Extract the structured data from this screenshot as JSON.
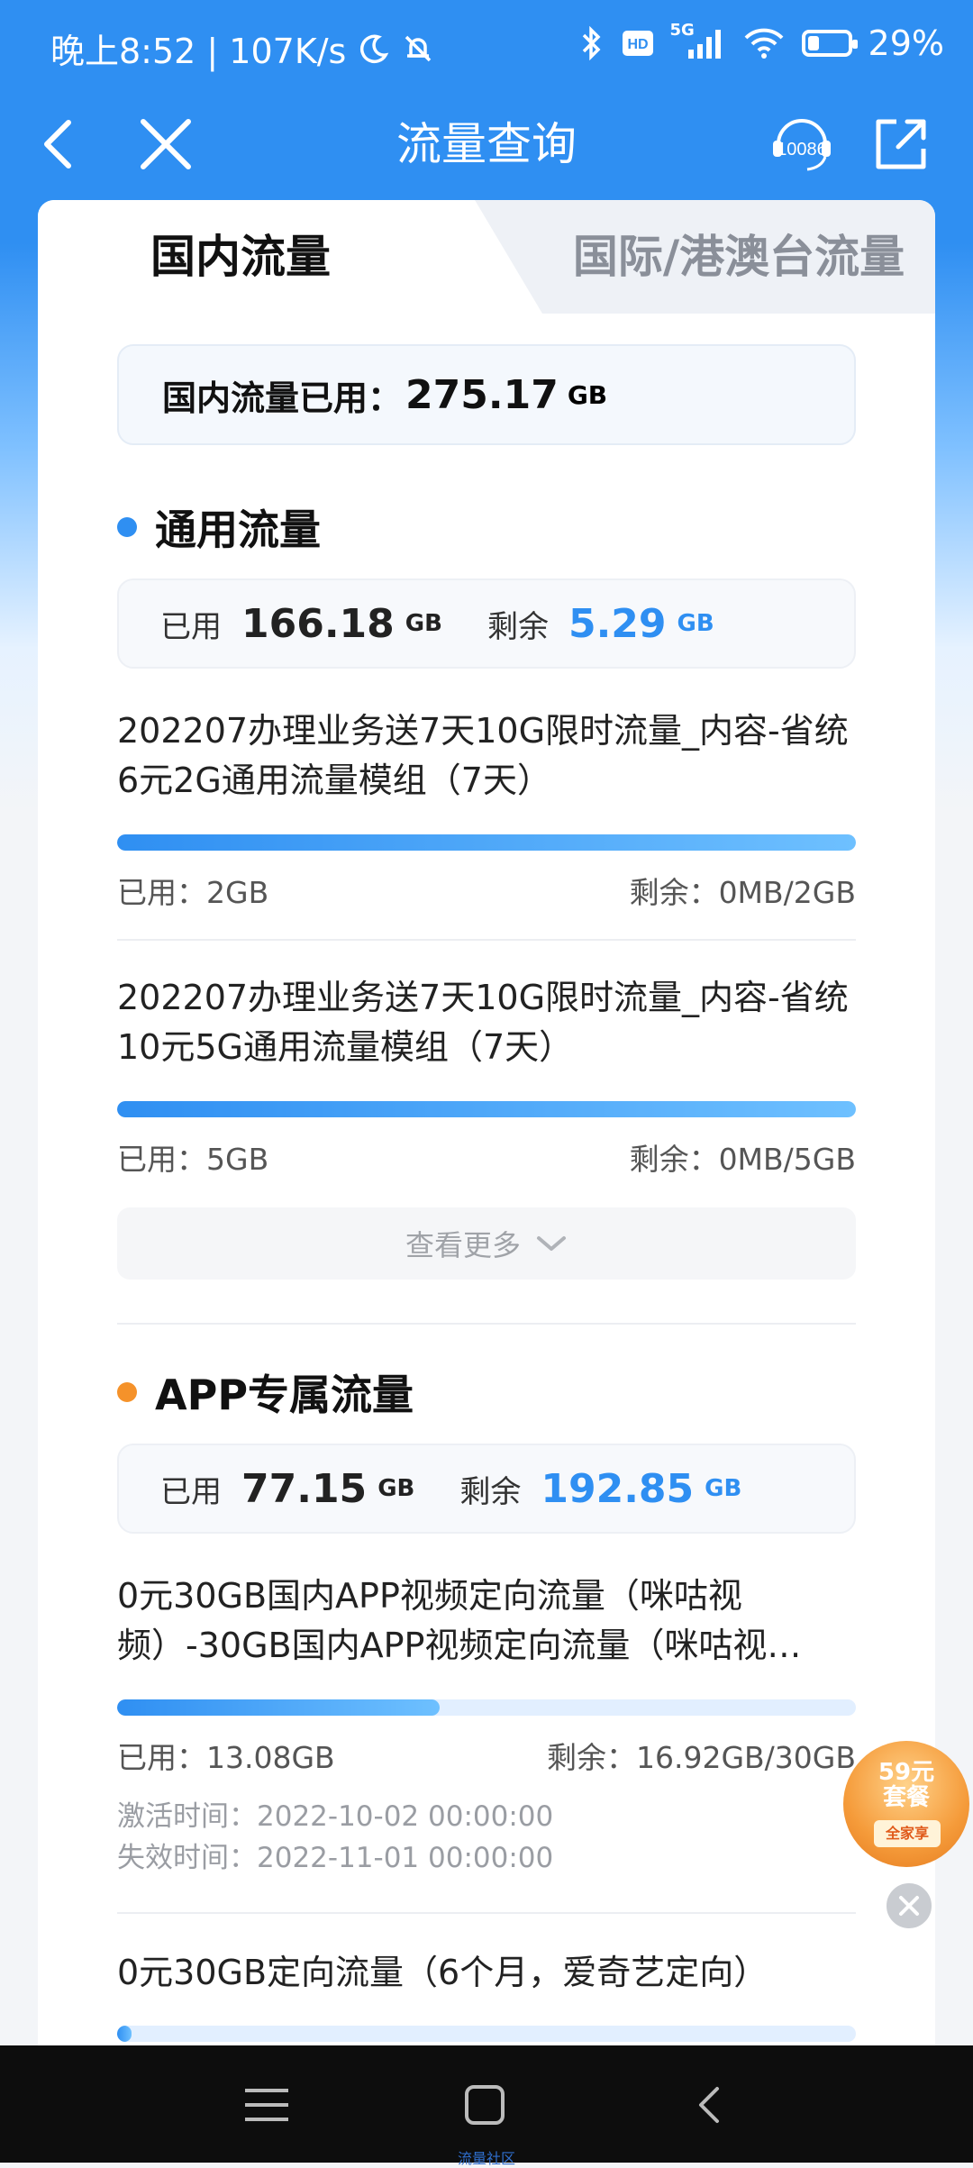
{
  "status_bar": {
    "time_speed": "晚上8:52 | 107K/s",
    "network": "5G",
    "battery_pct": "29%",
    "battery_level": 0.29
  },
  "nav": {
    "title": "流量查询",
    "service_label": "10086"
  },
  "tabs": {
    "active": "国内流量",
    "inactive": "国际/港澳台流量"
  },
  "total": {
    "label": "国内流量已用：",
    "value": "275.17",
    "unit": "GB"
  },
  "general": {
    "title": "通用流量",
    "used_label": "已用",
    "used_value": "166.18",
    "used_unit": "GB",
    "remain_label": "剩余",
    "remain_value": "5.29",
    "remain_unit": "GB",
    "items": [
      {
        "name": "202207办理业务送7天10G限时流量_内容-省统6元2G通用流量模组（7天）",
        "used": "已用：2GB",
        "remain": "剩余：0MB/2GB",
        "progress": 1.0
      },
      {
        "name": "202207办理业务送7天10G限时流量_内容-省统10元5G通用流量模组（7天）",
        "used": "已用：5GB",
        "remain": "剩余：0MB/5GB",
        "progress": 1.0
      }
    ],
    "more_label": "查看更多"
  },
  "app": {
    "title": "APP专属流量",
    "used_label": "已用",
    "used_value": "77.15",
    "used_unit": "GB",
    "remain_label": "剩余",
    "remain_value": "192.85",
    "remain_unit": "GB",
    "items": [
      {
        "name": "0元30GB国内APP视频定向流量（咪咕视频）-30GB国内APP视频定向流量（咪咕视…",
        "used": "已用：13.08GB",
        "remain": "剩余：16.92GB/30GB",
        "progress": 0.436,
        "activate": "激活时间：2022-10-02 00:00:00",
        "expire": "失效时间：2022-11-01 00:00:00"
      },
      {
        "name": "0元30GB定向流量（6个月，爱奇艺定向）",
        "progress": 0.02
      }
    ]
  },
  "promo": {
    "line1": "59元",
    "line2": "套餐",
    "badge": "全家享"
  },
  "bottom": {
    "watermark": "流量社区"
  },
  "colors": {
    "accent": "#2f8ff2",
    "orange_dot": "#f5922a",
    "blue_dot": "#2f8ff2"
  }
}
